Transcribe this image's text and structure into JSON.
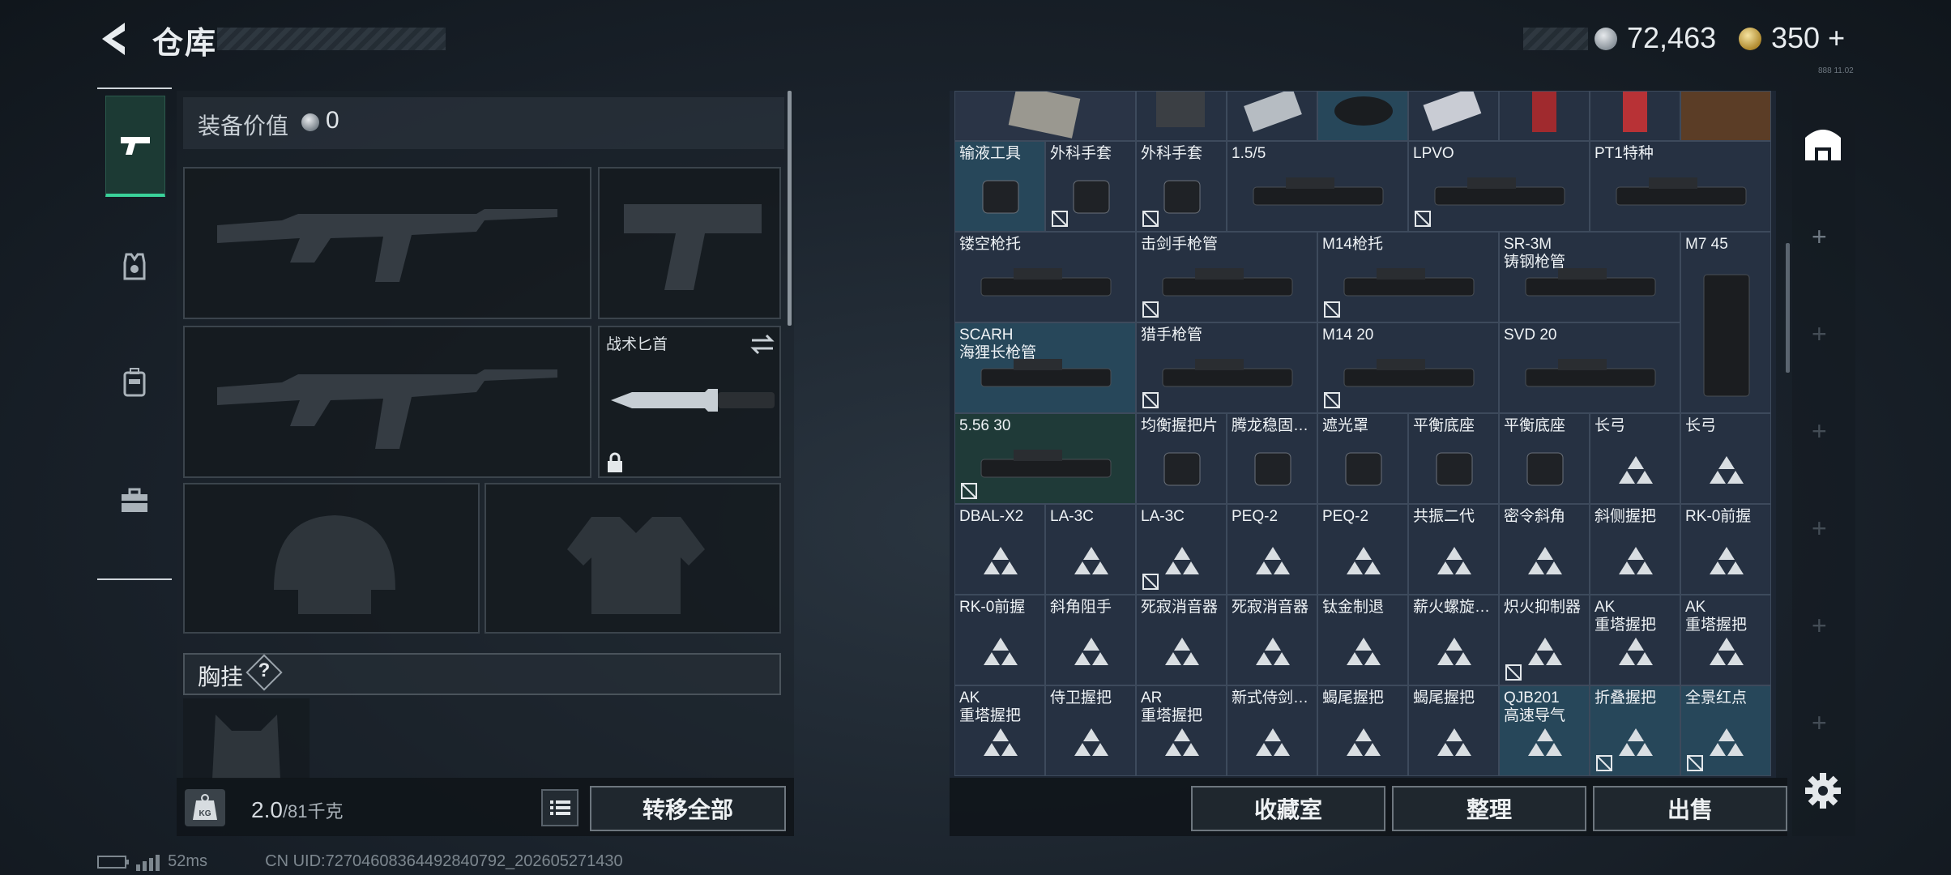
{
  "header": {
    "title": "仓库",
    "currency_silver": "72,463",
    "currency_gold": "350",
    "gold_plus": "+",
    "tiny_text": "888 11.02"
  },
  "loadout": {
    "equipment_value_label": "装备价值",
    "equipment_value": "0",
    "knife_label": "战术匕首",
    "chest_rig_label": "胸挂",
    "chest_help": "?"
  },
  "bottom_left": {
    "kg_label": "KG",
    "weight_value": "2.0",
    "weight_max": "/81千克",
    "transfer_all": "转移全部"
  },
  "status_bar": {
    "ping": "52ms",
    "uid": "CN UID:7270460836449284079​2_202605271430"
  },
  "inventory": {
    "items": [
      {
        "label": "输液工具",
        "col": 0,
        "row": 0,
        "w": 1,
        "h": 1,
        "bg": "teal",
        "nolink": false
      },
      {
        "label": "外科手套",
        "col": 1,
        "row": 0,
        "w": 1,
        "h": 1,
        "bg": "",
        "nolink": true
      },
      {
        "label": "外科手套",
        "col": 2,
        "row": 0,
        "w": 1,
        "h": 1,
        "bg": "",
        "nolink": true
      },
      {
        "label": "1.5/5",
        "col": 3,
        "row": 0,
        "w": 2,
        "h": 1,
        "bg": "",
        "nolink": false
      },
      {
        "label": "LPVO",
        "col": 5,
        "row": 0,
        "w": 2,
        "h": 1,
        "bg": "",
        "nolink": true
      },
      {
        "label": "PT1特种",
        "col": 7,
        "row": 0,
        "w": 2,
        "h": 1,
        "bg": "",
        "nolink": false
      },
      {
        "label": "镂空枪托",
        "col": 0,
        "row": 1,
        "w": 2,
        "h": 1,
        "bg": "",
        "nolink": false
      },
      {
        "label": "击剑手枪管",
        "col": 2,
        "row": 1,
        "w": 2,
        "h": 1,
        "bg": "",
        "nolink": true
      },
      {
        "label": "M14枪托",
        "col": 4,
        "row": 1,
        "w": 2,
        "h": 1,
        "bg": "",
        "nolink": true
      },
      {
        "label": "SR-3M\n铸钢枪管",
        "col": 6,
        "row": 1,
        "w": 2,
        "h": 1,
        "bg": "",
        "nolink": false
      },
      {
        "label": "M7 45",
        "col": 8,
        "row": 1,
        "w": 1,
        "h": 2,
        "bg": "",
        "nolink": false
      },
      {
        "label": "SCARH\n海狸长枪管",
        "col": 0,
        "row": 2,
        "w": 2,
        "h": 1,
        "bg": "teal",
        "nolink": false
      },
      {
        "label": "猎手枪管",
        "col": 2,
        "row": 2,
        "w": 2,
        "h": 1,
        "bg": "",
        "nolink": true
      },
      {
        "label": "M14 20",
        "col": 4,
        "row": 2,
        "w": 2,
        "h": 1,
        "bg": "",
        "nolink": true
      },
      {
        "label": "SVD 20",
        "col": 6,
        "row": 2,
        "w": 2,
        "h": 1,
        "bg": "",
        "nolink": false
      },
      {
        "label": "5.56 30",
        "col": 0,
        "row": 3,
        "w": 2,
        "h": 1,
        "bg": "dark",
        "nolink": true
      },
      {
        "label": "均衡握把片",
        "col": 2,
        "row": 3,
        "w": 1,
        "h": 1,
        "bg": "",
        "nolink": false
      },
      {
        "label": "腾龙稳固…",
        "col": 3,
        "row": 3,
        "w": 1,
        "h": 1,
        "bg": "",
        "nolink": false
      },
      {
        "label": "遮光罩",
        "col": 4,
        "row": 3,
        "w": 1,
        "h": 1,
        "bg": "",
        "nolink": false
      },
      {
        "label": "平衡底座",
        "col": 5,
        "row": 3,
        "w": 1,
        "h": 1,
        "bg": "",
        "nolink": false
      },
      {
        "label": "平衡底座",
        "col": 6,
        "row": 3,
        "w": 1,
        "h": 1,
        "bg": "",
        "nolink": false
      },
      {
        "label": "长弓",
        "col": 7,
        "row": 3,
        "w": 1,
        "h": 1,
        "bg": "",
        "nolink": false,
        "tri": true
      },
      {
        "label": "长弓",
        "col": 8,
        "row": 3,
        "w": 1,
        "h": 1,
        "bg": "",
        "nolink": false,
        "tri": true
      },
      {
        "label": "DBAL-X2",
        "col": 0,
        "row": 4,
        "w": 1,
        "h": 1,
        "bg": "",
        "nolink": false,
        "tri": true
      },
      {
        "label": "LA-3C",
        "col": 1,
        "row": 4,
        "w": 1,
        "h": 1,
        "bg": "",
        "nolink": false,
        "tri": true
      },
      {
        "label": "LA-3C",
        "col": 2,
        "row": 4,
        "w": 1,
        "h": 1,
        "bg": "",
        "nolink": true,
        "tri": true
      },
      {
        "label": "PEQ-2",
        "col": 3,
        "row": 4,
        "w": 1,
        "h": 1,
        "bg": "",
        "nolink": false,
        "tri": true
      },
      {
        "label": "PEQ-2",
        "col": 4,
        "row": 4,
        "w": 1,
        "h": 1,
        "bg": "",
        "nolink": false,
        "tri": true
      },
      {
        "label": "共振二代",
        "col": 5,
        "row": 4,
        "w": 1,
        "h": 1,
        "bg": "",
        "nolink": false,
        "tri": true
      },
      {
        "label": "密令斜角",
        "col": 6,
        "row": 4,
        "w": 1,
        "h": 1,
        "bg": "",
        "nolink": false,
        "tri": true
      },
      {
        "label": "斜侧握把",
        "col": 7,
        "row": 4,
        "w": 1,
        "h": 1,
        "bg": "",
        "nolink": false,
        "tri": true
      },
      {
        "label": "RK-0前握",
        "col": 8,
        "row": 4,
        "w": 1,
        "h": 1,
        "bg": "",
        "nolink": false,
        "tri": true
      },
      {
        "label": "RK-0前握",
        "col": 0,
        "row": 5,
        "w": 1,
        "h": 1,
        "bg": "",
        "nolink": false,
        "tri": true
      },
      {
        "label": "斜角阻手",
        "col": 1,
        "row": 5,
        "w": 1,
        "h": 1,
        "bg": "",
        "nolink": false,
        "tri": true
      },
      {
        "label": "死寂消音器",
        "col": 2,
        "row": 5,
        "w": 1,
        "h": 1,
        "bg": "",
        "nolink": false,
        "tri": true
      },
      {
        "label": "死寂消音器",
        "col": 3,
        "row": 5,
        "w": 1,
        "h": 1,
        "bg": "",
        "nolink": false,
        "tri": true
      },
      {
        "label": "钛金制退",
        "col": 4,
        "row": 5,
        "w": 1,
        "h": 1,
        "bg": "",
        "nolink": false,
        "tri": true
      },
      {
        "label": "薪火螺旋…",
        "col": 5,
        "row": 5,
        "w": 1,
        "h": 1,
        "bg": "",
        "nolink": false,
        "tri": true
      },
      {
        "label": "炽火抑制器",
        "col": 6,
        "row": 5,
        "w": 1,
        "h": 1,
        "bg": "",
        "nolink": true,
        "tri": true
      },
      {
        "label": "AK\n重塔握把",
        "col": 7,
        "row": 5,
        "w": 1,
        "h": 1,
        "bg": "",
        "nolink": false,
        "tri": true
      },
      {
        "label": "AK\n重塔握把",
        "col": 8,
        "row": 5,
        "w": 1,
        "h": 1,
        "bg": "",
        "nolink": false,
        "tri": true
      },
      {
        "label": "AK\n重塔握把",
        "col": 0,
        "row": 6,
        "w": 1,
        "h": 1,
        "bg": "",
        "nolink": false,
        "tri": true
      },
      {
        "label": "侍卫握把",
        "col": 1,
        "row": 6,
        "w": 1,
        "h": 1,
        "bg": "",
        "nolink": false,
        "tri": true
      },
      {
        "label": "AR\n重塔握把",
        "col": 2,
        "row": 6,
        "w": 1,
        "h": 1,
        "bg": "",
        "nolink": false,
        "tri": true
      },
      {
        "label": "新式侍剑…",
        "col": 3,
        "row": 6,
        "w": 1,
        "h": 1,
        "bg": "",
        "nolink": false,
        "tri": true
      },
      {
        "label": "蝎尾握把",
        "col": 4,
        "row": 6,
        "w": 1,
        "h": 1,
        "bg": "",
        "nolink": false,
        "tri": true
      },
      {
        "label": "蝎尾握把",
        "col": 5,
        "row": 6,
        "w": 1,
        "h": 1,
        "bg": "",
        "nolink": false,
        "tri": true
      },
      {
        "label": "QJB201\n高速导气",
        "col": 6,
        "row": 6,
        "w": 1,
        "h": 1,
        "bg": "teal",
        "nolink": false,
        "tri": true
      },
      {
        "label": "折叠握把",
        "col": 7,
        "row": 6,
        "w": 1,
        "h": 1,
        "bg": "teal",
        "nolink": true,
        "tri": true
      },
      {
        "label": "全景红点",
        "col": 8,
        "row": 6,
        "w": 1,
        "h": 1,
        "bg": "teal",
        "nolink": true,
        "tri": true
      }
    ]
  },
  "bottom_right": {
    "collection_room": "收藏室",
    "sort": "整理",
    "sell": "出售"
  },
  "colors": {
    "accent_green": "#3ad29a",
    "cell_bg": "#263142",
    "cell_teal": "#27475a"
  }
}
